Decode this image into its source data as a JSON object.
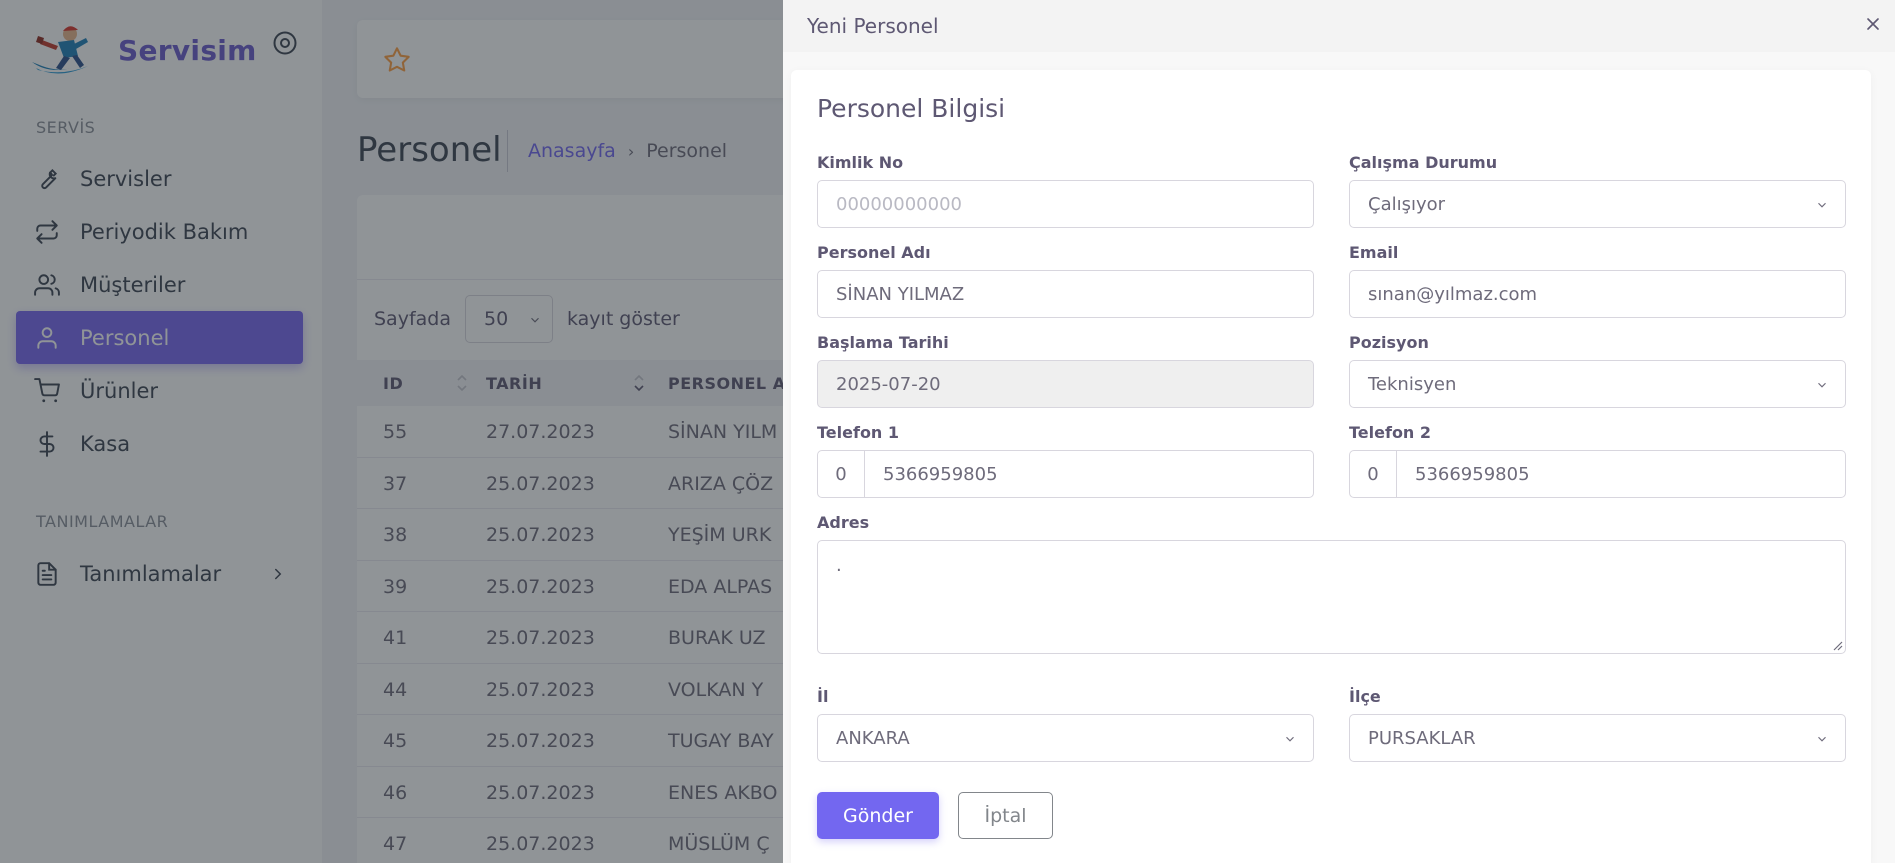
{
  "app": {
    "brand_name": "Servisim",
    "sections": {
      "servis": "SERVİS",
      "tanimlamalar": "TANIMLAMALAR"
    },
    "nav": [
      {
        "label": "Servisler",
        "icon": "wrench-icon"
      },
      {
        "label": "Periyodik Bakım",
        "icon": "repeat-icon"
      },
      {
        "label": "Müşteriler",
        "icon": "users-icon"
      },
      {
        "label": "Personel",
        "icon": "user-icon",
        "active": true
      },
      {
        "label": "Ürünler",
        "icon": "cart-icon"
      },
      {
        "label": "Kasa",
        "icon": "dollar-icon"
      },
      {
        "label": "Tanımlamalar",
        "icon": "file-icon"
      }
    ]
  },
  "page": {
    "title": "Personel",
    "breadcrumb": {
      "home": "Anasayfa",
      "current": "Personel"
    },
    "page_size": {
      "prefix": "Sayfada",
      "value": "50",
      "suffix": "kayıt göster"
    },
    "columns": [
      "ID",
      "TARİH",
      "PERSONEL A"
    ],
    "rows": [
      {
        "id": "55",
        "date": "27.07.2023",
        "name": "SİNAN YILM"
      },
      {
        "id": "37",
        "date": "25.07.2023",
        "name": "ARIZA ÇÖZ"
      },
      {
        "id": "38",
        "date": "25.07.2023",
        "name": "YEŞİM URK"
      },
      {
        "id": "39",
        "date": "25.07.2023",
        "name": "EDA ALPAS"
      },
      {
        "id": "41",
        "date": "25.07.2023",
        "name": "BURAK UZ"
      },
      {
        "id": "44",
        "date": "25.07.2023",
        "name": "VOLKAN Y"
      },
      {
        "id": "45",
        "date": "25.07.2023",
        "name": "TUGAY BAY"
      },
      {
        "id": "46",
        "date": "25.07.2023",
        "name": "ENES AKBO"
      },
      {
        "id": "47",
        "date": "25.07.2023",
        "name": "MÜSLÜM Ç"
      }
    ]
  },
  "panel": {
    "title": "Yeni Personel",
    "heading": "Personel Bilgisi",
    "fields": {
      "kimlik": {
        "label": "Kimlik No",
        "placeholder": "00000000000",
        "value": ""
      },
      "calisma": {
        "label": "Çalışma Durumu",
        "value": "Çalışıyor"
      },
      "adi": {
        "label": "Personel Adı",
        "value": "SİNAN YILMAZ"
      },
      "email": {
        "label": "Email",
        "value": "sınan@yılmaz.com"
      },
      "baslama": {
        "label": "Başlama Tarihi",
        "value": "2025-07-20"
      },
      "pozisyon": {
        "label": "Pozisyon",
        "value": "Teknisyen"
      },
      "tel1": {
        "label": "Telefon 1",
        "prefix": "0",
        "value": "5366959805"
      },
      "tel2": {
        "label": "Telefon 2",
        "prefix": "0",
        "value": "5366959805"
      },
      "adres": {
        "label": "Adres",
        "value": "."
      },
      "il": {
        "label": "İl",
        "value": "ANKARA"
      },
      "ilce": {
        "label": "İlçe",
        "value": "PURSAKLAR"
      }
    },
    "buttons": {
      "submit": "Gönder",
      "cancel": "İptal"
    }
  },
  "colors": {
    "accent": "#7367f0",
    "sidebar_active": "#7867f0",
    "brand": "#6a5acd"
  }
}
